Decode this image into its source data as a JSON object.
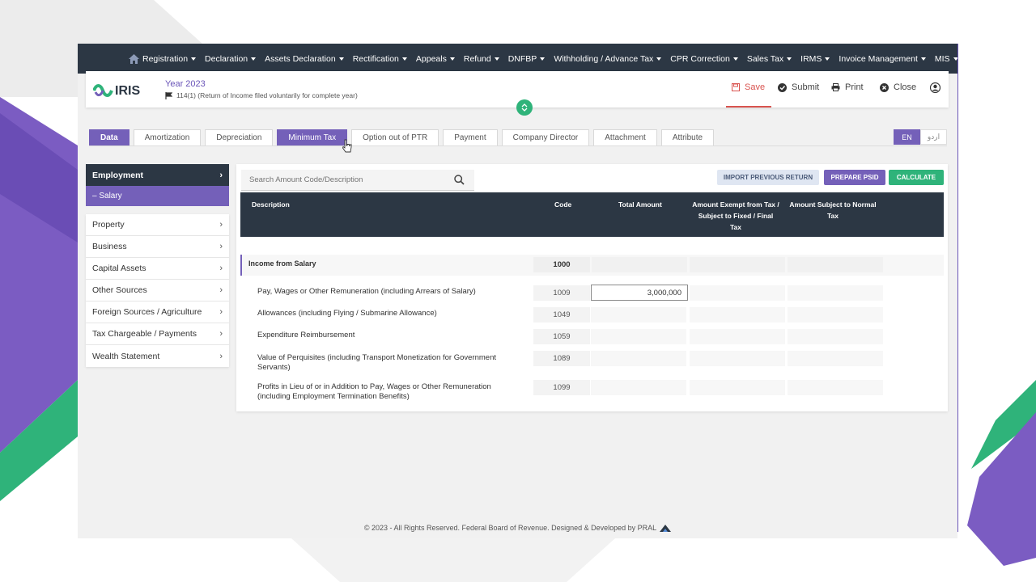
{
  "colors": {
    "nav_bg": "#2c3744",
    "accent_purple": "#7460b9",
    "accent_green": "#2fb37a",
    "save_red": "#d9534f"
  },
  "topnav": {
    "items": [
      {
        "label": "Registration"
      },
      {
        "label": "Declaration"
      },
      {
        "label": "Assets Declaration"
      },
      {
        "label": "Rectification"
      },
      {
        "label": "Appeals"
      },
      {
        "label": "Refund"
      },
      {
        "label": "DNFBP"
      },
      {
        "label": "Withholding / Advance Tax"
      },
      {
        "label": "CPR Correction"
      },
      {
        "label": "Sales Tax"
      },
      {
        "label": "IRMS"
      },
      {
        "label": "Invoice Management"
      },
      {
        "label": "MIS"
      }
    ]
  },
  "header": {
    "logo_text": "IRIS",
    "year": "Year 2023",
    "return_type": "114(1) (Return of Income filed voluntarily for complete year)",
    "save": "Save",
    "submit": "Submit",
    "print": "Print",
    "close": "Close"
  },
  "tabs": [
    {
      "label": "Data"
    },
    {
      "label": "Amortization"
    },
    {
      "label": "Depreciation"
    },
    {
      "label": "Minimum Tax"
    },
    {
      "label": "Option out of PTR"
    },
    {
      "label": "Payment"
    },
    {
      "label": "Company Director"
    },
    {
      "label": "Attachment"
    },
    {
      "label": "Attribute"
    }
  ],
  "lang": {
    "en": "EN",
    "ur": "اردو"
  },
  "sidebar": {
    "head": "Employment",
    "sub": "– Salary",
    "items": [
      {
        "label": "Property"
      },
      {
        "label": "Business"
      },
      {
        "label": "Capital Assets"
      },
      {
        "label": "Other Sources"
      },
      {
        "label": "Foreign Sources / Agriculture"
      },
      {
        "label": "Tax Chargeable / Payments"
      },
      {
        "label": "Wealth Statement"
      }
    ]
  },
  "main": {
    "search_placeholder": "Search Amount Code/Description",
    "import_btn": "IMPORT PREVIOUS RETURN",
    "psid_btn": "PREPARE PSID",
    "calc_btn": "CALCULATE",
    "columns": {
      "description": "Description",
      "code": "Code",
      "total": "Total Amount",
      "exempt": "Amount Exempt from Tax / Subject to Fixed / Final Tax",
      "normal": "Amount Subject to Normal Tax"
    },
    "section": {
      "label": "Income from Salary",
      "code": "1000"
    },
    "rows": [
      {
        "label": "Pay, Wages or Other Remuneration (including Arrears of Salary)",
        "code": "1009",
        "total": "3,000,000"
      },
      {
        "label": "Allowances (including Flying / Submarine Allowance)",
        "code": "1049",
        "total": ""
      },
      {
        "label": "Expenditure Reimbursement",
        "code": "1059",
        "total": ""
      },
      {
        "label": "Value of Perquisites (including Transport Monetization for Government Servants)",
        "code": "1089",
        "total": ""
      },
      {
        "label": "Profits in Lieu of or in Addition to Pay, Wages or Other Remuneration (including Employment Termination Benefits)",
        "code": "1099",
        "total": ""
      }
    ]
  },
  "footer": "© 2023 - All Rights Reserved. Federal Board of Revenue. Designed & Developed by PRAL"
}
